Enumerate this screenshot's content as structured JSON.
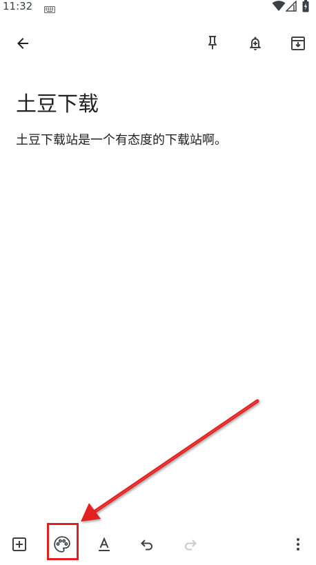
{
  "status_bar": {
    "time": "11:32",
    "icons": [
      "keyboard-icon",
      "wifi-icon",
      "signal-icon",
      "battery-icon"
    ]
  },
  "top_bar": {
    "icons": [
      "back-arrow-icon",
      "pin-icon",
      "reminder-bell-icon",
      "archive-icon"
    ]
  },
  "note": {
    "title": "土豆下载",
    "body": "土豆下载站是一个有态度的下载站啊。"
  },
  "bottom_bar": {
    "icons": [
      "add-box-icon",
      "palette-icon",
      "text-format-icon",
      "undo-icon",
      "redo-icon",
      "more-vert-icon"
    ],
    "redo_enabled": false
  },
  "annotation": {
    "highlight_color": "#e02020",
    "target": "palette-icon"
  },
  "colors": {
    "icon": "#3c4043",
    "icon_disabled": "#c8c9cb",
    "annotation_red": "#e02020"
  }
}
